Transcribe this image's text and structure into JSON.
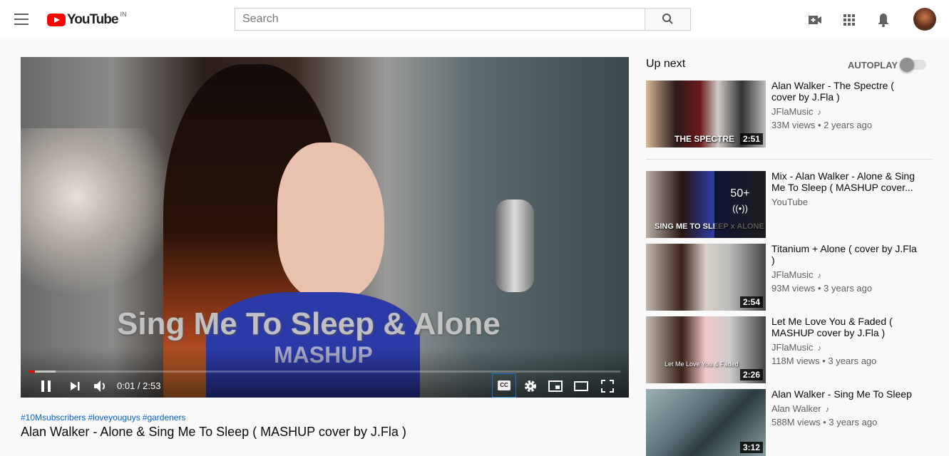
{
  "header": {
    "logo_text": "YouTube",
    "country": "IN",
    "search_placeholder": "Search"
  },
  "player": {
    "overlay_line1": "Sing Me To Sleep & Alone",
    "overlay_line2": "MASHUP",
    "time": "0:01 / 2:53",
    "progress_fraction": 0.006,
    "buffered_fraction": 0.045,
    "cc_label": "CC",
    "accent": "#ff0000"
  },
  "video": {
    "hashtags": [
      "#10Msubscribers",
      "#loveyouguys",
      "#gardeners"
    ],
    "title": "Alan Walker - Alone & Sing Me To Sleep ( MASHUP cover by J.Fla )"
  },
  "sidebar": {
    "up_next": "Up next",
    "autoplay_label": "AUTOPLAY",
    "autoplay_on": false,
    "items": [
      {
        "title": "Alan Walker - The Spectre ( cover by J.Fla )",
        "channel": "JFlaMusic",
        "meta": "33M views • 2 years ago",
        "duration": "2:51",
        "thumb_text": "THE SPECTRE"
      },
      {
        "title": "Mix - Alan Walker - Alone & Sing Me To Sleep ( MASHUP cover...",
        "channel": "YouTube",
        "count": "50+",
        "thumb_text": "SING ME TO SLEEP x ALONE"
      },
      {
        "title": "Titanium + Alone ( cover by J.Fla )",
        "channel": "JFlaMusic",
        "meta": "93M views • 3 years ago",
        "duration": "2:54"
      },
      {
        "title": "Let Me Love You & Faded ( MASHUP cover by J.Fla )",
        "channel": "JFlaMusic",
        "meta": "118M views • 3 years ago",
        "duration": "2:26",
        "thumb_text": "Let Me Love You & Faded"
      },
      {
        "title": "Alan Walker - Sing Me To Sleep",
        "channel": "Alan Walker",
        "meta": "588M views • 3 years ago",
        "duration": "3:12"
      }
    ]
  }
}
